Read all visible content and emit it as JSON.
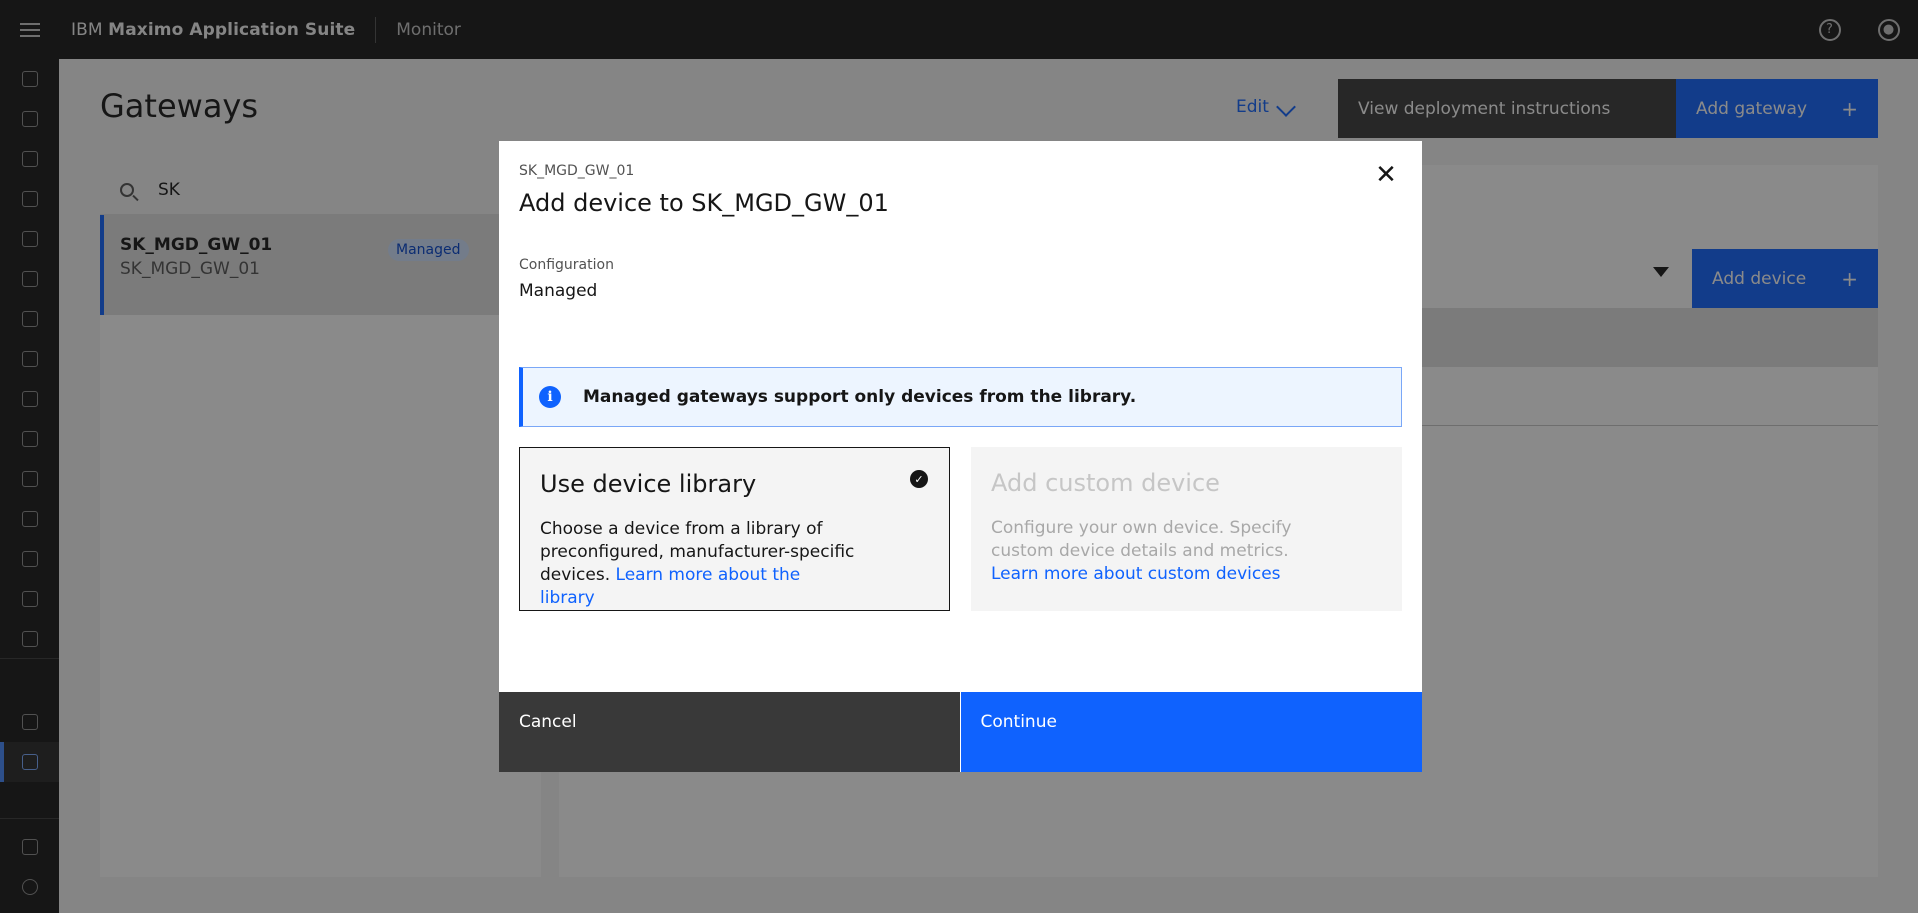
{
  "header": {
    "brand_prefix": "IBM",
    "brand_suite": "Maximo Application Suite",
    "app_name": "Monitor",
    "help_icon": "help-icon",
    "user_icon": "user-icon"
  },
  "page": {
    "title": "Gateways",
    "edit_label": "Edit",
    "view_instructions_label": "View deployment instructions",
    "add_gateway_label": "Add gateway",
    "plus_glyph": "+"
  },
  "list": {
    "search_value": "SK",
    "items": [
      {
        "name": "SK_MGD_GW_01",
        "subtitle": "SK_MGD_GW_01",
        "tag": "Managed"
      }
    ]
  },
  "detail": {
    "add_device_label": "Add device"
  },
  "modal": {
    "label": "SK_MGD_GW_01",
    "title": "Add device to SK_MGD_GW_01",
    "config_label": "Configuration",
    "config_value": "Managed",
    "notice_text": "Managed gateways support only devices from the library.",
    "close_glyph": "✕",
    "tiles": [
      {
        "title": "Use device library",
        "desc": "Choose a device from a library of preconfigured, manufacturer-specific devices.",
        "link": "Learn more about the library",
        "selected": true
      },
      {
        "title": "Add custom device",
        "desc": "Configure your own device. Specify custom device details and metrics.",
        "link": "Learn more about custom devices",
        "selected": false
      }
    ],
    "cancel_label": "Cancel",
    "continue_label": "Continue"
  },
  "colors": {
    "primary": "#0f62fe",
    "header_bg": "#161616",
    "secondary_button": "#393939",
    "tag_bg": "#d0e2ff"
  }
}
